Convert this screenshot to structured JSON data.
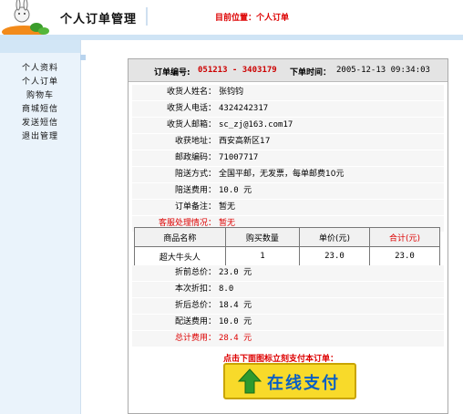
{
  "header": {
    "title": "个人订单管理",
    "location": "目前位置：个人订单"
  },
  "sidebar": {
    "items": [
      {
        "label": "个人资料"
      },
      {
        "label": "个人订单"
      },
      {
        "label": "购物车"
      },
      {
        "label": "商城短信"
      },
      {
        "label": "发送短信"
      },
      {
        "label": "退出管理"
      }
    ]
  },
  "order": {
    "number_label": "订单编号:",
    "number": "051213 - 3403179",
    "time_label": "下单时间：",
    "time": "2005-12-13 09:34:03",
    "fields": [
      {
        "label": "收货人姓名：",
        "value": "张钧钧"
      },
      {
        "label": "收货人电话：",
        "value": "4324242317"
      },
      {
        "label": "收货人邮箱：",
        "value": "sc_zj@163.com17"
      },
      {
        "label": "收获地址：",
        "value": "西安高新区17"
      },
      {
        "label": "邮政编码：",
        "value": "71007717"
      },
      {
        "label": "陪送方式：",
        "value": "全国平邮，无发票，每单邮费10元"
      },
      {
        "label": "陪送费用：",
        "value": "10.0 元"
      },
      {
        "label": "订单备注：",
        "value": "暂无"
      },
      {
        "label": "客服处理情况：",
        "value": "暂无"
      }
    ],
    "table": {
      "headers": [
        "商品名称",
        "购买数量",
        "单价(元)",
        "合计(元)"
      ],
      "rows": [
        [
          "超大牛头人",
          "1",
          "23.0",
          "23.0"
        ]
      ]
    },
    "totals": [
      {
        "label": "折前总价：",
        "value": "23.0 元"
      },
      {
        "label": "本次折扣：",
        "value": "8.0"
      },
      {
        "label": "折后总价：",
        "value": "18.4 元"
      },
      {
        "label": "配送费用：",
        "value": "10.0 元"
      },
      {
        "label": "总计费用：",
        "value": "28.4 元"
      }
    ],
    "pay_note": "点击下面图标立刻支付本订单：",
    "pay_button": "在线支付"
  },
  "colors": {
    "accent_red": "#dd0000",
    "pay_yellow": "#f8da2a",
    "pay_blue": "#0a5fc4"
  }
}
